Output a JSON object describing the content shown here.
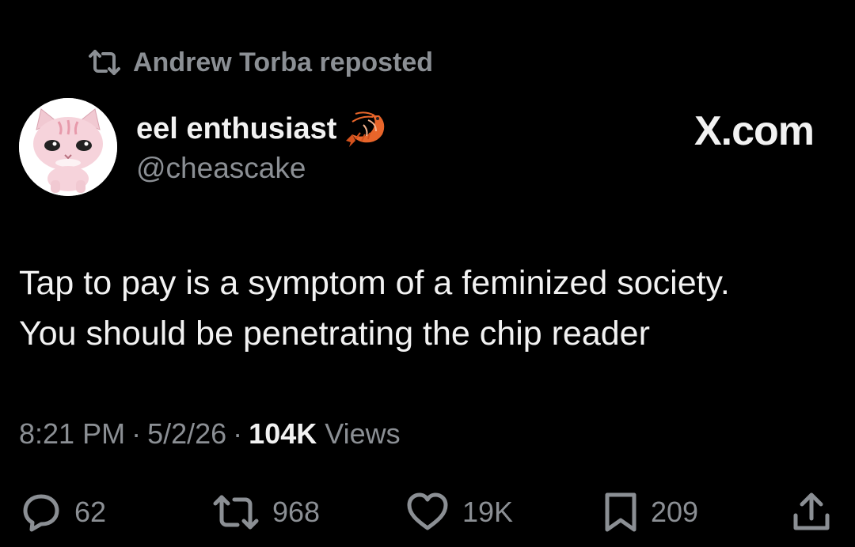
{
  "repost": {
    "icon": "repost-icon",
    "label": "Andrew Torba reposted"
  },
  "author": {
    "display_name": "eel enthusiast",
    "badge_icon": "shrimp-emoji-icon",
    "handle": "@cheascake",
    "avatar": "pink-cat-figurine-avatar"
  },
  "brand": {
    "label": "X.com"
  },
  "tweet": {
    "lines": [
      "Tap to pay is a symptom of a feminized society.",
      "You should be penetrating the chip reader"
    ]
  },
  "meta": {
    "time": "8:21 PM",
    "separator": "·",
    "date": "5/2/26",
    "views_count": "104K",
    "views_label": "Views"
  },
  "actions": {
    "replies": {
      "icon": "reply-icon",
      "count": "62"
    },
    "reposts": {
      "icon": "repost-icon",
      "count": "968"
    },
    "likes": {
      "icon": "heart-icon",
      "count": "19K"
    },
    "bookmarks": {
      "icon": "bookmark-icon",
      "count": "209"
    },
    "share": {
      "icon": "share-icon"
    }
  },
  "colors": {
    "background": "#000000",
    "primary_text": "#f2f2f2",
    "secondary_text": "#8b8f94",
    "shrimp": "#e8652a"
  }
}
